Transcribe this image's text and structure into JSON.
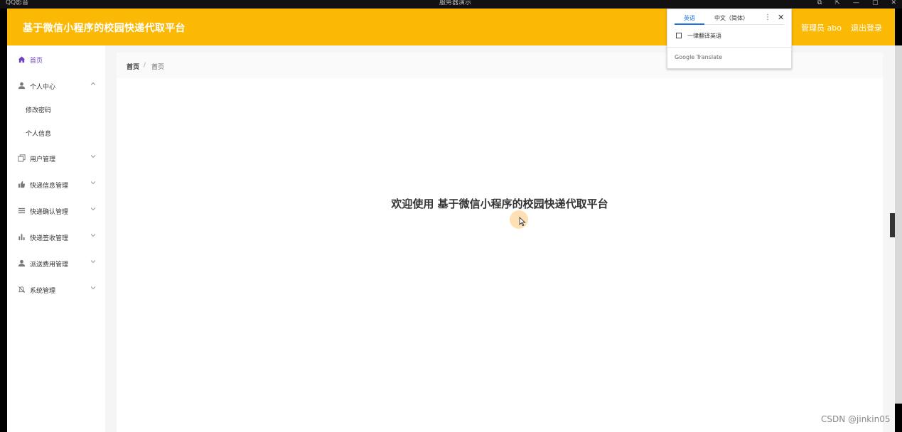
{
  "osbar": {
    "left_text": "QQ影音",
    "center_text": "服务器演示",
    "controls": [
      "⧉",
      "⇱",
      "—",
      "▢",
      "✕"
    ]
  },
  "header": {
    "title": "基于微信小程序的校园快递代取平台",
    "user": "管理员 abo",
    "logout": "退出登录"
  },
  "sidebar": {
    "accent": "#6f42c1",
    "items": [
      {
        "label": "首页",
        "icon": "home-icon",
        "active": true
      },
      {
        "label": "个人中心",
        "icon": "user-icon",
        "expanded": true,
        "children": [
          {
            "label": "修改密码"
          },
          {
            "label": "个人信息"
          }
        ]
      },
      {
        "label": "用户管理",
        "icon": "copy-icon"
      },
      {
        "label": "快递信息管理",
        "icon": "thumb-icon"
      },
      {
        "label": "快递确认管理",
        "icon": "list-icon"
      },
      {
        "label": "快递签收管理",
        "icon": "bar-chart-icon"
      },
      {
        "label": "派送费用管理",
        "icon": "user-icon"
      },
      {
        "label": "系统管理",
        "icon": "bell-off-icon"
      }
    ]
  },
  "breadcrumb": {
    "home": "首页",
    "separator": "/",
    "current": "首页"
  },
  "main": {
    "welcome": "欢迎使用 基于微信小程序的校园快递代取平台"
  },
  "translate_popup": {
    "tab_source": "英语",
    "tab_target": "中文（简体）",
    "more": "⋮",
    "close": "✕",
    "always_translate": "一律翻译英语",
    "brand": "Google Translate"
  },
  "watermark": "CSDN @jinkin05",
  "colors": {
    "header": "#fbb805",
    "active": "#6f42c1",
    "link_blue": "#1a73e8"
  }
}
